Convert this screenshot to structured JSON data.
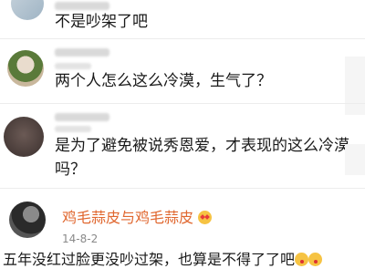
{
  "comments": [
    {
      "text": "不是吵架了吧"
    },
    {
      "text": "两个人怎么这么冷漠，生气了？"
    },
    {
      "line1": "是为了避免被说秀恩爱，才表现的这么冷漠",
      "line2": "吗？"
    },
    {
      "username": "鸡毛蒜皮与鸡毛蒜皮",
      "date": "14-8-2",
      "text": "五年没红过脸更没吵过架，也算是不得了了吧",
      "emojis": [
        "heart-eyes-emoji",
        "kiss-emoji",
        "kiss-emoji"
      ]
    }
  ],
  "colors": {
    "username": "#e0672f",
    "text": "#1a1a1a",
    "date": "#8a8a8a"
  }
}
